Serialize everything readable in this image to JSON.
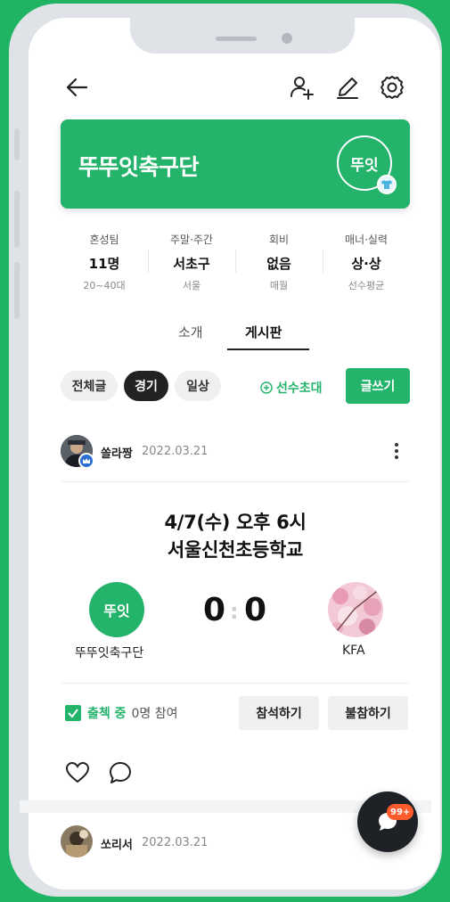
{
  "team": {
    "name": "뚜뚜잇축구단",
    "logo_text": "뚜잇"
  },
  "stats": [
    {
      "label": "혼성팀",
      "value": "11명",
      "sub": "20~40대"
    },
    {
      "label": "주말·주간",
      "value": "서초구",
      "sub": "서울"
    },
    {
      "label": "회비",
      "value": "없음",
      "sub": "매월"
    },
    {
      "label": "매너·실력",
      "value": "상·상",
      "sub": "선수평균"
    }
  ],
  "tabs": {
    "intro": "소개",
    "board": "게시판",
    "active": "board"
  },
  "filters": {
    "all": "전체글",
    "match": "경기",
    "daily": "일상",
    "active": "match"
  },
  "actions": {
    "invite_label": "선수초대",
    "write_label": "글쓰기"
  },
  "post": {
    "author": "쏠라짱",
    "date": "2022.03.21",
    "match_time": "4/7(수) 오후 6시",
    "match_place": "서울신천초등학교",
    "home_logo_text": "뚜잇",
    "home_name": "뚜뚜잇축구단",
    "home_score": "0",
    "away_score": "0",
    "away_name": "KFA",
    "attendance_status": "출첵 중",
    "attendance_count": "0명 참여",
    "attend_button": "참석하기",
    "absent_button": "불참하기"
  },
  "next_post": {
    "author": "쏘리서",
    "date": "2022.03.21"
  },
  "fab": {
    "badge": "99+"
  },
  "colors": {
    "brand": "#23b36a",
    "background": "#1fb463",
    "badge": "#ff5a2c"
  }
}
